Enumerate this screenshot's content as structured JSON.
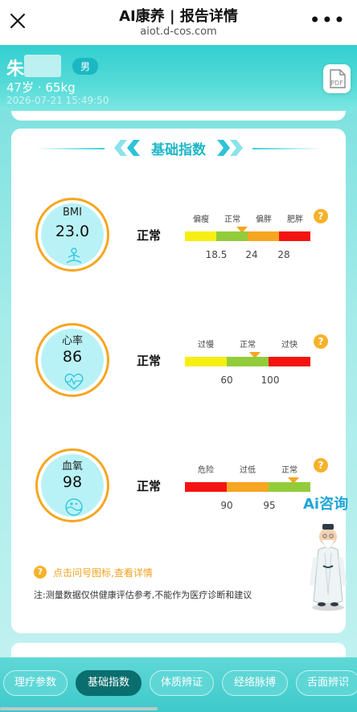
{
  "browser": {
    "title": "AI康养 | 报告详情",
    "url": "aiot.d-cos.com",
    "close_icon": "close-icon",
    "more_icon": "more-icon"
  },
  "patient": {
    "name": "朱",
    "gender": "男",
    "age_weight": "47岁 · 65kg",
    "timestamp": "2026-07-21 15:49:50",
    "pdf_icon": "pdf-icon"
  },
  "section": {
    "title": "基础指数",
    "accent_color": "#1fb7c8"
  },
  "metrics": [
    {
      "label": "BMI",
      "value": "23.0",
      "status": "正常",
      "icon": "meditation-icon",
      "scale_labels": [
        "偏瘦",
        "正常",
        "偏胖",
        "肥胖"
      ],
      "scale_values": [
        "18.5",
        "24",
        "28"
      ],
      "colors": [
        "#f7ef14",
        "#93cc3a",
        "#f6a621",
        "#f31411"
      ]
    },
    {
      "label": "心率",
      "value": "86",
      "status": "正常",
      "icon": "heart-rate-icon",
      "scale_labels": [
        "过慢",
        "正常",
        "过快"
      ],
      "scale_values": [
        "60",
        "100"
      ],
      "colors": [
        "#f7ef14",
        "#93cc3a",
        "#f31411"
      ]
    },
    {
      "label": "血氧",
      "value": "98",
      "status": "正常",
      "icon": "oxygen-icon",
      "scale_labels": [
        "危险",
        "过低",
        "正常"
      ],
      "scale_values": [
        "90",
        "95"
      ],
      "colors": [
        "#f31411",
        "#f6a621",
        "#93cc3a"
      ]
    }
  ],
  "hint": "点击问号图标,查看详情",
  "note": "注:测量数据仅供健康评估参考,不能作为医疗诊断和建议",
  "ai": {
    "label": "Ai咨询",
    "avatar_icon": "sage-avatar-icon"
  },
  "tabs": [
    {
      "label": "理疗参数",
      "active": false
    },
    {
      "label": "基础指数",
      "active": true
    },
    {
      "label": "体质辨证",
      "active": false
    },
    {
      "label": "经络脉搏",
      "active": false
    },
    {
      "label": "舌面辨识",
      "active": false
    }
  ]
}
